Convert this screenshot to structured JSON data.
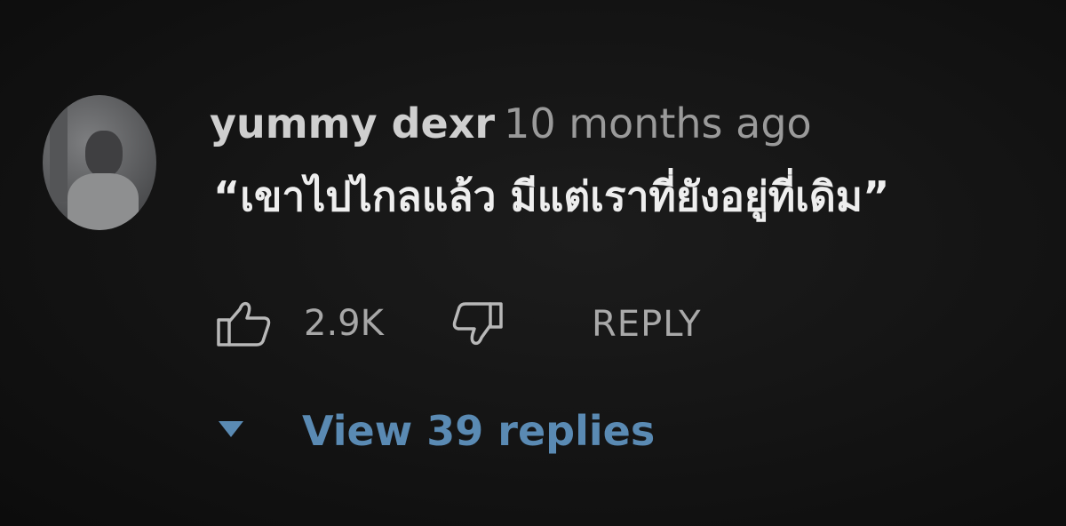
{
  "comment": {
    "author": "yummy dexr",
    "timestamp": "10 months ago",
    "text": "“เขาไปไกลแล้ว มีแต่เราที่ยังอยู่ที่เดิม”",
    "like_count": "2.9K",
    "reply_label": "REPLY",
    "view_replies_label": "View 39 replies"
  },
  "icons": {
    "like": "thumbs-up-icon",
    "dislike": "thumbs-down-icon",
    "expand": "caret-down-icon"
  },
  "colors": {
    "background": "#151515",
    "author": "#cfcfcf",
    "timestamp": "#9a9a9a",
    "comment_text": "#eeeeee",
    "action_gray": "#a9a9a9",
    "link_blue": "#5a8ab3"
  }
}
